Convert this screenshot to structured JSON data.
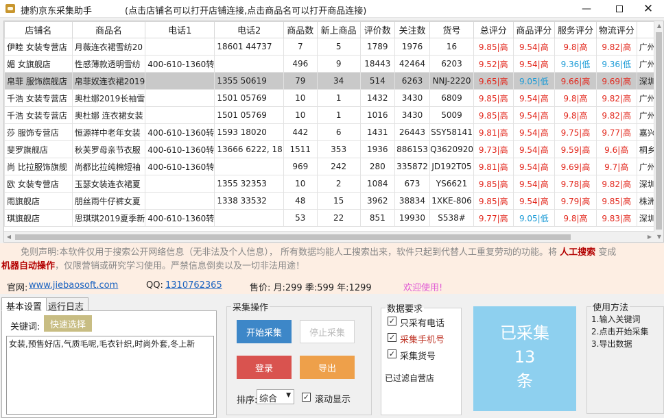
{
  "window": {
    "title": "捷豹京东采集助手",
    "hint": "(点击店铺名可以打开店铺连接,点击商品名可以打开商品连接)",
    "min_glyph": "—",
    "close_glyph": "✕"
  },
  "table": {
    "headers": [
      "店铺名",
      "商品名",
      "电话1",
      "电话2",
      "商品数",
      "新上商品",
      "评价数",
      "关注数",
      "货号",
      "总评分",
      "商品评分",
      "服务评分",
      "物流评分",
      ""
    ],
    "rows": [
      [
        "伊睦 女装专营店",
        "月薇连衣裙雪纺20",
        "",
        "18601 44737",
        "7",
        "5",
        "1789",
        "1976",
        "16",
        "9.85|高",
        "9.54|高",
        "9.8|高",
        "9.82|高",
        "广州"
      ],
      [
        "媚 女旗舰店",
        "性感薄款透明雪纺",
        "400-610-1360转",
        "",
        "496",
        "9",
        "18443",
        "42464",
        "6203",
        "9.52|高",
        "9.54|高",
        "9.36|低",
        "9.36|低",
        "广州"
      ],
      [
        "帛菲 服饰旗舰店",
        "帛菲奴连衣裙2019",
        "",
        "1355 50619",
        "79",
        "34",
        "514",
        "6263",
        "NNJ-2220",
        "9.65|高",
        "9.05|低",
        "9.66|高",
        "9.69|高",
        "深圳"
      ],
      [
        "千浩 女装专营店",
        "奥杜娜2019长袖雪",
        "",
        "1501 05769",
        "10",
        "1",
        "1432",
        "3430",
        "6809",
        "9.85|高",
        "9.54|高",
        "9.8|高",
        "9.82|高",
        "广州"
      ],
      [
        "千浩 女装专营店",
        "奥杜娜 连衣裙女装",
        "",
        "1501 05769",
        "10",
        "1",
        "1016",
        "3430",
        "5009",
        "9.85|高",
        "9.54|高",
        "9.8|高",
        "9.82|高",
        "广州"
      ],
      [
        "莎 服饰专营店",
        "恒源祥中老年女装",
        "400-610-1360转",
        "1593 18020",
        "442",
        "6",
        "1431",
        "26443",
        "SSY58141",
        "9.81|高",
        "9.54|高",
        "9.75|高",
        "9.77|高",
        "嘉兴"
      ],
      [
        "斐罗旗舰店",
        "秋芙罗母亲节衣服",
        "400-610-1360转",
        "13666 6222, 18",
        "1511",
        "353",
        "1936",
        "886153",
        "Q3620920",
        "9.73|高",
        "9.54|高",
        "9.59|高",
        "9.6|高",
        "桐乡"
      ],
      [
        "尚 比拉服饰旗舰",
        "尚都比拉纯棉短袖",
        "400-610-1360转",
        "",
        "969",
        "242",
        "280",
        "335872",
        "JD192T05",
        "9.81|高",
        "9.54|高",
        "9.69|高",
        "9.7|高",
        "广州"
      ],
      [
        "欧 女装专营店",
        "玉瑟女装连衣裙夏",
        "",
        "1355 32353",
        "10",
        "2",
        "1084",
        "673",
        "YS6621",
        "9.85|高",
        "9.54|高",
        "9.78|高",
        "9.82|高",
        "深圳"
      ],
      [
        "雨旗舰店",
        "朋丝雨牛仔裤女夏",
        "",
        "1338 33532",
        "48",
        "15",
        "3962",
        "38834",
        "1XKE-806",
        "9.85|高",
        "9.54|高",
        "9.79|高",
        "9.85|高",
        "株洲"
      ],
      [
        "琪旗舰店",
        "思琪琪2019夏季新",
        "400-610-1360转",
        "",
        "53",
        "22",
        "851",
        "19930",
        "S538#",
        "9.77|高",
        "9.05|低",
        "9.8|高",
        "9.83|高",
        "深圳"
      ]
    ],
    "selected_row": 2
  },
  "disclaimer": {
    "line1": "免则声明:本软件仅用于搜索公开网络信息（无非法及个人信息）， 所有数据均能人工搜索出来，软件只起到代替人工重复劳动的功能。将",
    "bold1": "人工搜索",
    "mid": "变成",
    "bold2": "机器自动操作",
    "line2": "，仅限营销或研究学习使用。严禁信息倒卖以及一切非法用途！"
  },
  "info": {
    "site_label": "官网:",
    "site": "www.jiebaosoft.com",
    "qq_label": "QQ:",
    "qq": "1310762365",
    "price": "售价: 月:299  季:599  年:1299",
    "welcome": "欢迎使用!"
  },
  "tabs": [
    "基本设置",
    "运行日志"
  ],
  "settings": {
    "keyword_label": "关键词:",
    "quick_select": "快速选择",
    "keywords": "女装,预售好店,气质毛呢,毛衣针织,时尚外套,冬上新"
  },
  "collect": {
    "legend": "采集操作",
    "start": "开始采集",
    "stop": "停止采集",
    "login": "登录",
    "export": "导出",
    "sort_label": "排序:",
    "sort_value": "综合",
    "scroll_label": "滚动显示"
  },
  "data_req": {
    "legend": "数据要求",
    "opt1": "只采有电话",
    "opt2": "采集手机号",
    "opt3": "采集货号",
    "filtered": "已过滤自营店"
  },
  "collected": {
    "line1": "已采集",
    "count": "13",
    "unit": "条"
  },
  "usage": {
    "legend": "使用方法",
    "step1": "1.输入关键词",
    "step2": "2.点击开始采集",
    "step3": "3.导出数据"
  }
}
